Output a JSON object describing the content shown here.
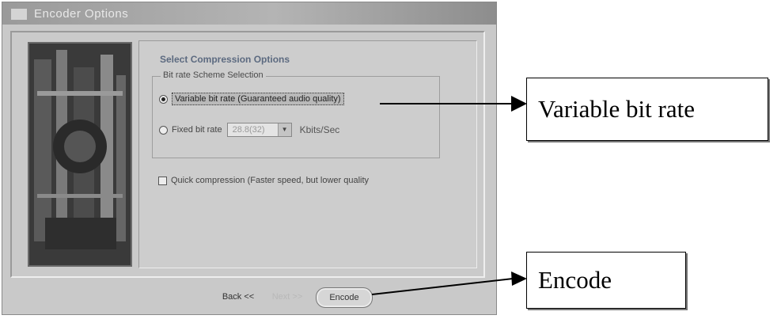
{
  "dialog": {
    "title": "Encoder Options",
    "content_title": "Select Compression Options",
    "group_label": "Bit rate Scheme Selection",
    "options": {
      "variable_label": "Variable bit rate (Guaranteed audio quality)",
      "variable_selected": true,
      "fixed_label": "Fixed bit rate",
      "fixed_selected": false,
      "fixed_value": "28.8(32)",
      "fixed_unit": "Kbits/Sec"
    },
    "quick_compression": {
      "label": "Quick compression (Faster speed, but lower quality",
      "checked": false
    },
    "buttons": {
      "back": "Back <<",
      "next": "Next >>",
      "encode": "Encode"
    }
  },
  "callouts": {
    "variable_bit_rate": "Variable bit rate",
    "encode": "Encode"
  }
}
